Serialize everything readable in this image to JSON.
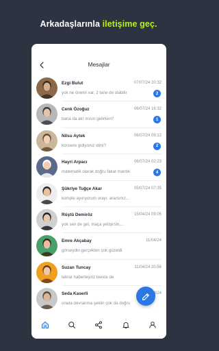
{
  "promo": {
    "headline_pre": "Arkadaşlarınla ",
    "headline_accent": "iletişime geç."
  },
  "colors": {
    "background": "#2d3340",
    "accent": "#b9f21c",
    "brand": "#2b78e4"
  },
  "header": {
    "title": "Mesajlar",
    "back_icon": "chevron-left-icon"
  },
  "conversations": [
    {
      "name": "Ezgi Bulut",
      "date": "07/07/24",
      "time": "20:32",
      "preview": "yok ne önemi var, 2 tane de olabilir",
      "unread": "2"
    },
    {
      "name": "Cenk Özoğuz",
      "date": "06/07/24",
      "time": "16:32",
      "preview": "bana da alır mısın gelirken?",
      "unread": "1"
    },
    {
      "name": "Nilsu Aytek",
      "date": "06/07/24",
      "time": "09:12",
      "preview": "konsere gidiyoruz dimi?",
      "unread": "2"
    },
    {
      "name": "Hayri Arpacı",
      "date": "06/07/24",
      "time": "02:23",
      "preview": "matematik olarak doğru fakat mantık",
      "unread": "4"
    },
    {
      "name": "Şükriye Tuğçe Akar",
      "date": "05/07/24",
      "time": "07:35",
      "preview": "komple ayırıyorum orayı. ararsınız...",
      "unread": ""
    },
    {
      "name": "Rüştü Demiröz",
      "date": "15/04/24",
      "time": "09:05",
      "preview": "yok sen de gel, maça yetişirsin,...",
      "unread": ""
    },
    {
      "name": "Emre Akçabay",
      "date": "11/04/24",
      "time": "",
      "preview": "görseydin gerçekten çok güzeldi",
      "unread": ""
    },
    {
      "name": "Suzan Tuncay",
      "date": "11/04/24",
      "time": "20:56",
      "preview": "tekrar haberleşiriz bence de",
      "unread": ""
    },
    {
      "name": "Seda Kaserli",
      "date": "10/04/24",
      "time": "",
      "preview": "orada devranma şeklin çok da doğru",
      "unread": ""
    }
  ],
  "fab": {
    "icon": "pencil-icon"
  },
  "bottom_nav": [
    {
      "name": "home",
      "icon": "home-icon"
    },
    {
      "name": "search",
      "icon": "search-icon"
    },
    {
      "name": "share",
      "icon": "share-icon"
    },
    {
      "name": "notifications",
      "icon": "bell-icon"
    },
    {
      "name": "profile",
      "icon": "user-icon"
    }
  ]
}
